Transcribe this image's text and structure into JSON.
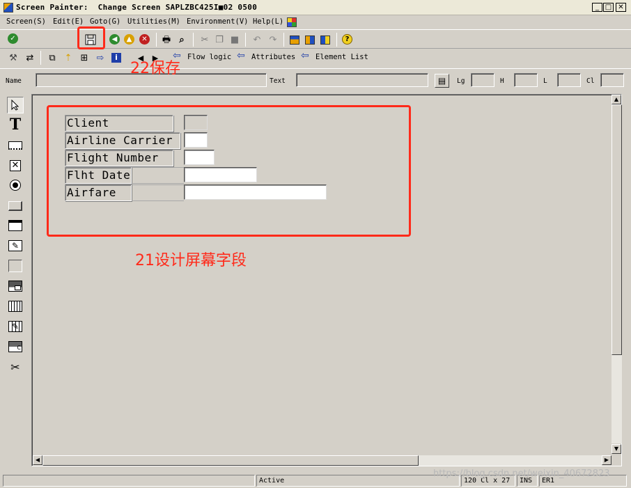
{
  "window": {
    "title": "Screen Painter:  Change Screen SAPLZBC425I■02 0500",
    "minimize_glyph": "_",
    "restore_glyph": "□",
    "close_glyph": "✕"
  },
  "menu": {
    "items": [
      {
        "label": "Screen(S)"
      },
      {
        "label": "Edit(E)"
      },
      {
        "label": "Goto(G)"
      },
      {
        "label": "Utilities(M)"
      },
      {
        "label": "Environment(V)"
      },
      {
        "label": "Help(L)"
      }
    ]
  },
  "toolbar2": {
    "flow_logic": "Flow logic",
    "attributes": "Attributes",
    "element_list": "Element List"
  },
  "props": {
    "name_label": "Name",
    "text_label": "Text",
    "lg_label": "Lg",
    "h_label": "H",
    "l_label": "L",
    "cl_label": "Cl"
  },
  "screen": {
    "fields": [
      {
        "label": "Client"
      },
      {
        "label": "Airline Carrier"
      },
      {
        "label": "Flight Number"
      },
      {
        "label": "Flht Date"
      },
      {
        "label": "Airfare"
      }
    ]
  },
  "annotations": {
    "save": "22保存",
    "design": "21设计屏幕字段"
  },
  "status": {
    "mode": "Active",
    "position": "120 Cl x 27",
    "insert": "INS",
    "code": "ER1"
  },
  "watermark": "https://blog.csdn.net/weixin_40672823",
  "colors": {
    "annotation_red": "#ff2a1a",
    "window_gray": "#d4d0c8",
    "arrow_blue": "#1f3ea8"
  }
}
